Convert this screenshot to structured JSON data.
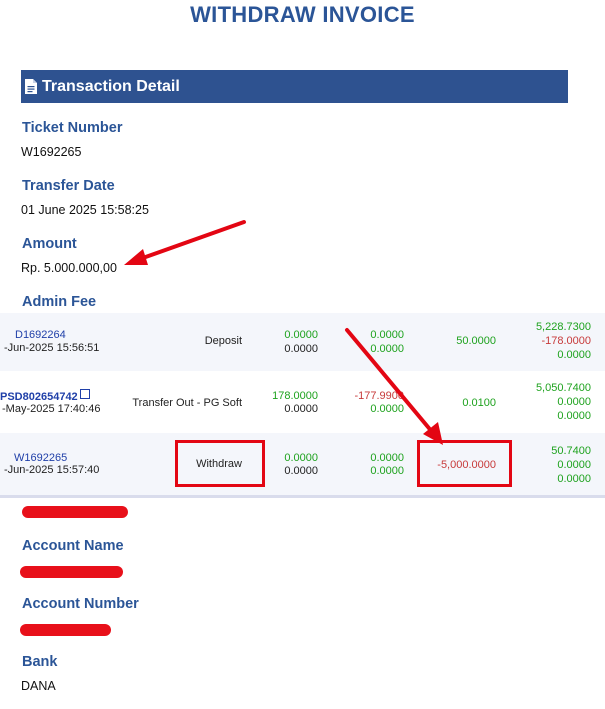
{
  "title": "WITHDRAW INVOICE",
  "section": {
    "title": "Transaction Detail",
    "icon": "document-icon"
  },
  "fields": {
    "ticket_number": {
      "label": "Ticket Number",
      "value": "W1692265"
    },
    "transfer_date": {
      "label": "Transfer Date",
      "value": "01 June 2025 15:58:25"
    },
    "amount": {
      "label": "Amount",
      "value": "Rp. 5.000.000,00"
    },
    "admin_fee": {
      "label": "Admin Fee"
    },
    "account_name": {
      "label": "Account Name"
    },
    "account_number": {
      "label": "Account Number"
    },
    "bank": {
      "label": "Bank",
      "value": "DANA"
    }
  },
  "transactions": [
    {
      "id": "D1692264",
      "date": "-Jun-2025 15:56:51",
      "type": "Deposit",
      "c1": [
        "0.0000",
        "0.0000"
      ],
      "c2": [
        "0.0000",
        "0.0000"
      ],
      "c3": "50.0000",
      "c4": [
        "5,228.7300",
        "-178.0000",
        "0.0000"
      ]
    },
    {
      "id": "PSD802654742",
      "date": "-May-2025 17:40:46",
      "type": "Transfer Out - PG Soft",
      "c1": [
        "178.0000",
        "0.0000"
      ],
      "c2": [
        "-177.9900",
        "0.0000"
      ],
      "c3": "0.0100",
      "c4": [
        "5,050.7400",
        "0.0000",
        "0.0000"
      ]
    },
    {
      "id": "W1692265",
      "date": "-Jun-2025 15:57:40",
      "type": "Withdraw",
      "c1": [
        "0.0000",
        "0.0000"
      ],
      "c2": [
        "0.0000",
        "0.0000"
      ],
      "c3": "-5,000.0000",
      "c4": [
        "50.7400",
        "0.0000",
        "0.0000"
      ]
    }
  ],
  "colors": {
    "header_bg": "#2e5290",
    "label": "#2b5597",
    "positive": "#1ea21e",
    "negative": "#c73a3a",
    "annotation": "#e30613"
  }
}
